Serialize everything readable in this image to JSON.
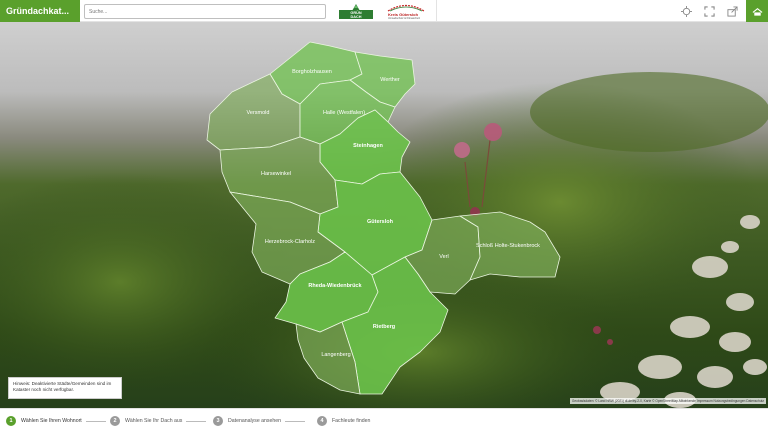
{
  "header": {
    "title": "Gründachkat...",
    "search_placeholder": "Suche...",
    "logo_gruendach_text": "GRÜN DACH",
    "logo_kreis_text": "Kreis Gütersloh",
    "logo_kreis_sub": "Umweltschutz & Klimaschutz"
  },
  "toolbar": {
    "icons": [
      "locate-icon",
      "fullscreen-icon",
      "share-icon",
      "roof-icon"
    ]
  },
  "map": {
    "districts": [
      {
        "name": "Borgholzhausen"
      },
      {
        "name": "Werther"
      },
      {
        "name": "Versmold"
      },
      {
        "name": "Halle (Westfalen)"
      },
      {
        "name": "Steinhagen"
      },
      {
        "name": "Harsewinkel"
      },
      {
        "name": "Gütersloh"
      },
      {
        "name": "Herzebrock-Clarholz"
      },
      {
        "name": "Verl"
      },
      {
        "name": "Schloß Holte-Stukenbrock"
      },
      {
        "name": "Rheda-Wiedenbrück"
      },
      {
        "name": "Rietberg"
      },
      {
        "name": "Langenberg"
      }
    ],
    "notice": "Hinweis: Deaktivierte Städte/Gemeinden sind im Kataster noch nicht verfügbar.",
    "attribution": "Geobasisdaten: © Land NRW (2021) dl-de/by-2-0, Karte © OpenStreetMap-Mitwirkende  Impressum  Nutzungsbedingungen  Datenschutz"
  },
  "steps": [
    {
      "num": "1",
      "label": "Wählen Sie Ihren Wohnort"
    },
    {
      "num": "2",
      "label": "Wählen Sie Ihr Dach aus"
    },
    {
      "num": "3",
      "label": "Datenanalyse ansehen"
    },
    {
      "num": "4",
      "label": "Fachleute finden"
    }
  ],
  "colors": {
    "brand_green": "#5aa02c",
    "district_fill": "#6cc24a",
    "district_fill_dim": "#7fae5a"
  }
}
